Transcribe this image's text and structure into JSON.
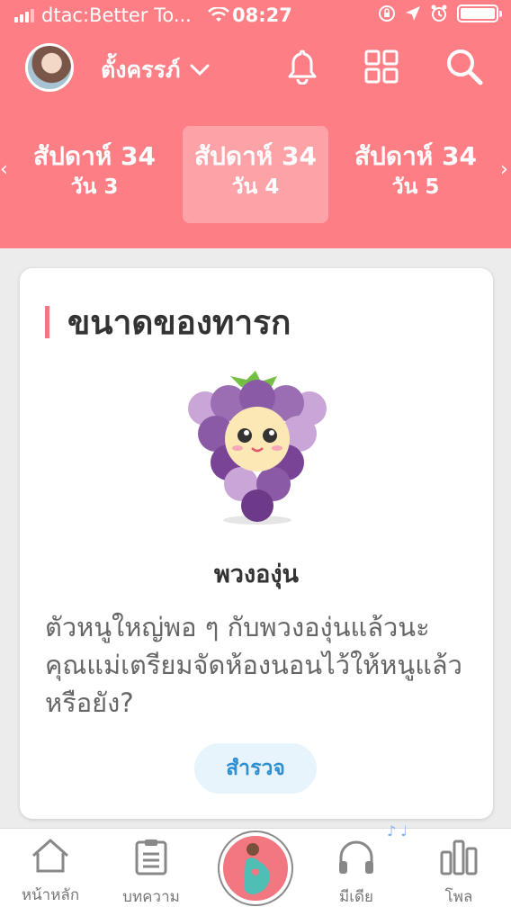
{
  "status_bar": {
    "carrier": "dtac:Better To...",
    "time": "08:27"
  },
  "header": {
    "username": "ตั้งครรภ์"
  },
  "weeks": [
    {
      "week": "สัปดาห์ 34",
      "day": "วัน 3"
    },
    {
      "week": "สัปดาห์ 34",
      "day": "วัน 4"
    },
    {
      "week": "สัปดาห์ 34",
      "day": "วัน 5"
    }
  ],
  "card": {
    "title": "ขนาดของทารก",
    "fruit_name": "พวงองุ่น",
    "description": "ตัวหนูใหญ่พอ ๆ กับพวงองุ่นแล้วนะ คุณแม่เตรียมจัดห้องนอนไว้ให้หนูแล้วหรือยัง?",
    "button": "สำรวจ"
  },
  "tabs": [
    {
      "label": "หน้าหลัก"
    },
    {
      "label": "บทความ"
    },
    {
      "label": "มีเดีย"
    },
    {
      "label": "โพล"
    }
  ],
  "colors": {
    "header": "#fd7f85",
    "accent": "#f27780",
    "link": "#2f8fd3"
  }
}
